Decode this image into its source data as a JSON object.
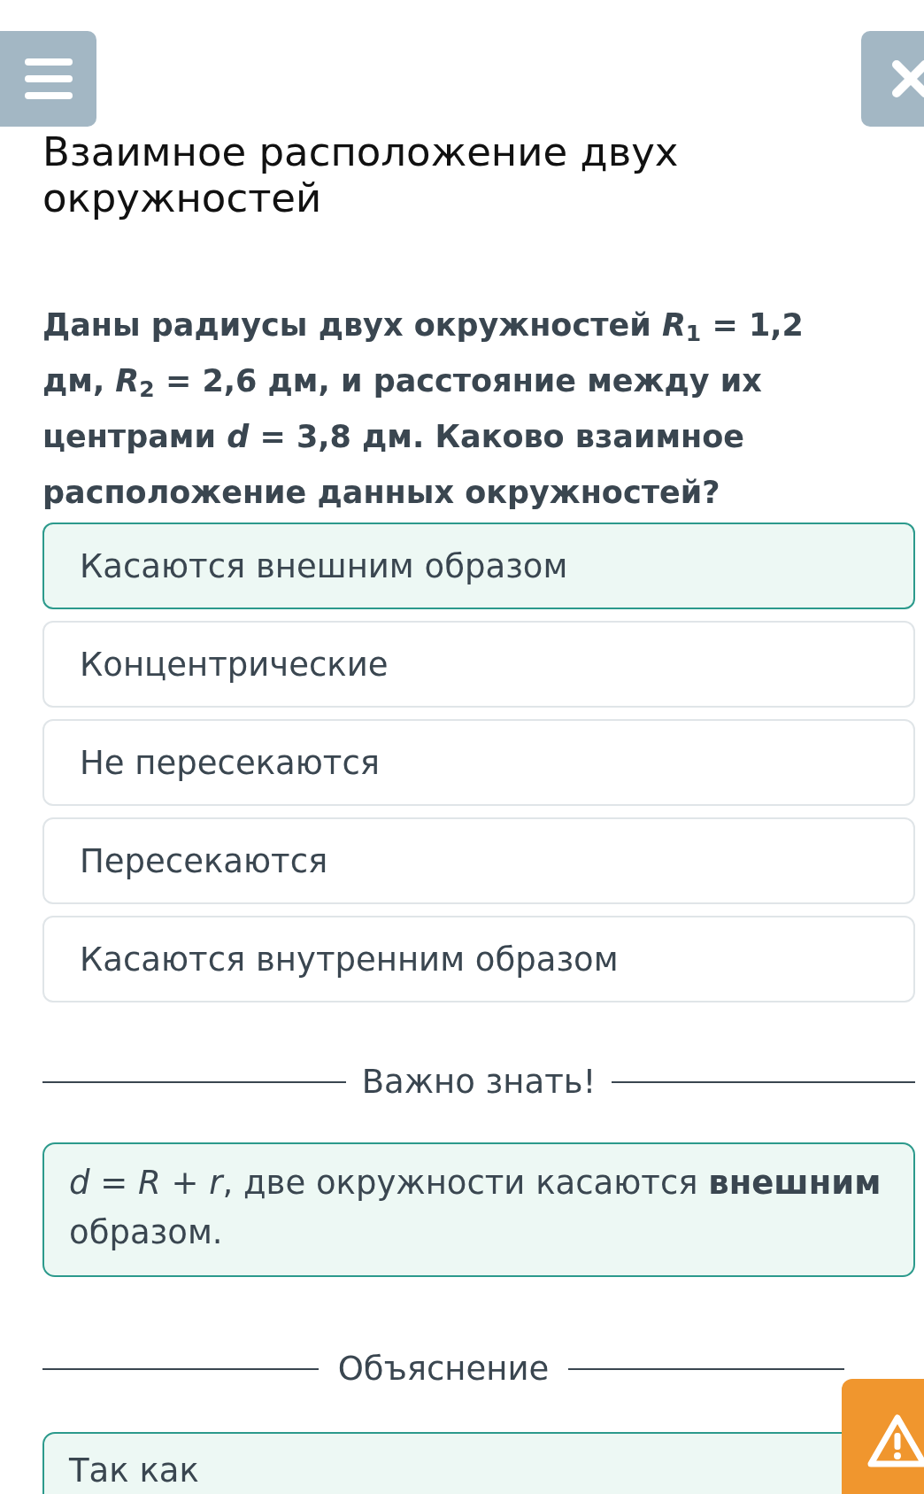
{
  "title": "Взаимное расположение двух окружностей",
  "question": "Даны радиусы двух окружностей *R*$_{1}$ = 1,2 дм, *R*$_{2}$ = 2,6 дм, и расстояние между их центрами *d* = 3,8 дм. Каково взаимное расположение данных окружностей?",
  "options": [
    {
      "label": "Касаются внешним образом",
      "selected": true
    },
    {
      "label": "Концентрические",
      "selected": false
    },
    {
      "label": "Не пересекаются",
      "selected": false
    },
    {
      "label": "Пересекаются",
      "selected": false
    },
    {
      "label": "Касаются внутренним образом",
      "selected": false
    }
  ],
  "important": {
    "heading": "Важно знать!",
    "text": "*d* = *R* + *r*, две окружности касаются **внешним** образом."
  },
  "explanation": {
    "heading": "Объяснение",
    "text": "Так как"
  }
}
